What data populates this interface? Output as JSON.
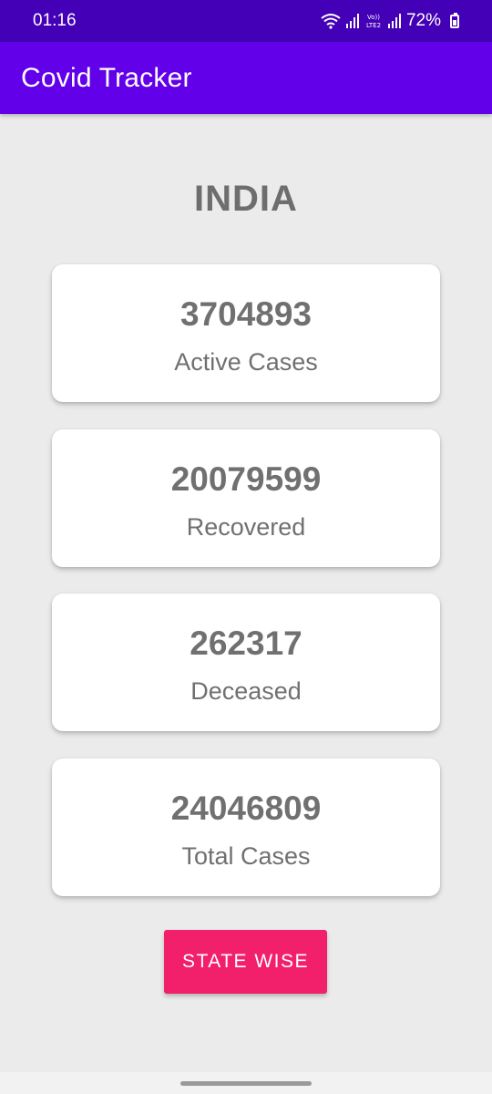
{
  "status_bar": {
    "time": "01:16",
    "lte_label": "Vo))\nLTE2",
    "battery": "72%",
    "icons": [
      "wifi-icon",
      "signal-icon",
      "volte-icon",
      "signal-icon",
      "battery-icon"
    ]
  },
  "app_bar": {
    "title": "Covid Tracker",
    "color": "#6200ea"
  },
  "country": "INDIA",
  "stats": [
    {
      "value": "3704893",
      "label": "Active Cases"
    },
    {
      "value": "20079599",
      "label": "Recovered"
    },
    {
      "value": "262317",
      "label": "Deceased"
    },
    {
      "value": "24046809",
      "label": "Total Cases"
    }
  ],
  "button": {
    "label": "STATE WISE",
    "color": "#f21f6b"
  }
}
